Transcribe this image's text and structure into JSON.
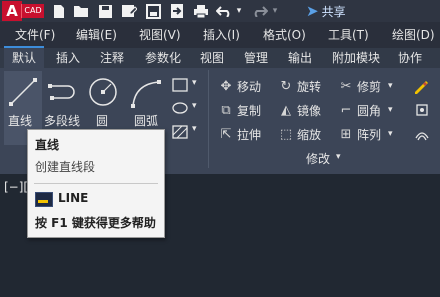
{
  "app": {
    "logo_letter": "A",
    "logo_suffix": "CAD"
  },
  "quick_access": {
    "share_label": "共享",
    "icons": [
      "new-file-icon",
      "open-folder-icon",
      "save-icon",
      "save-as-icon",
      "plot-save-icon",
      "import-icon",
      "export-icon",
      "print-icon",
      "undo-icon",
      "undo-dropdown-icon",
      "redo-icon",
      "redo-dropdown-icon",
      "share-icon"
    ]
  },
  "menubar": {
    "items": [
      "文件(F)",
      "编辑(E)",
      "视图(V)",
      "插入(I)",
      "格式(O)",
      "工具(T)",
      "绘图(D)"
    ]
  },
  "ribbon_tabs": {
    "items": [
      "默认",
      "插入",
      "注释",
      "参数化",
      "视图",
      "管理",
      "输出",
      "附加模块",
      "协作"
    ],
    "active": "默认"
  },
  "draw_panel": {
    "line": "直线",
    "polyline": "多段线",
    "circle": "圆",
    "arc": "圆弧"
  },
  "modify_panel": {
    "title": "修改",
    "move": "移动",
    "rotate": "旋转",
    "trim": "修剪",
    "copy": "复制",
    "mirror": "镜像",
    "fillet": "圆角",
    "stretch": "拉伸",
    "scale": "缩放",
    "array": "阵列"
  },
  "viewport": {
    "label": "[−]["
  },
  "tooltip": {
    "title": "直线",
    "description": "创建直线段",
    "command": "LINE",
    "help": "按 F1 键获得更多帮助"
  },
  "colors": {
    "accent": "#3d8ddb",
    "brand": "#c8102e",
    "ribbon_bg": "#3c4557",
    "canvas_bg": "#212832"
  }
}
